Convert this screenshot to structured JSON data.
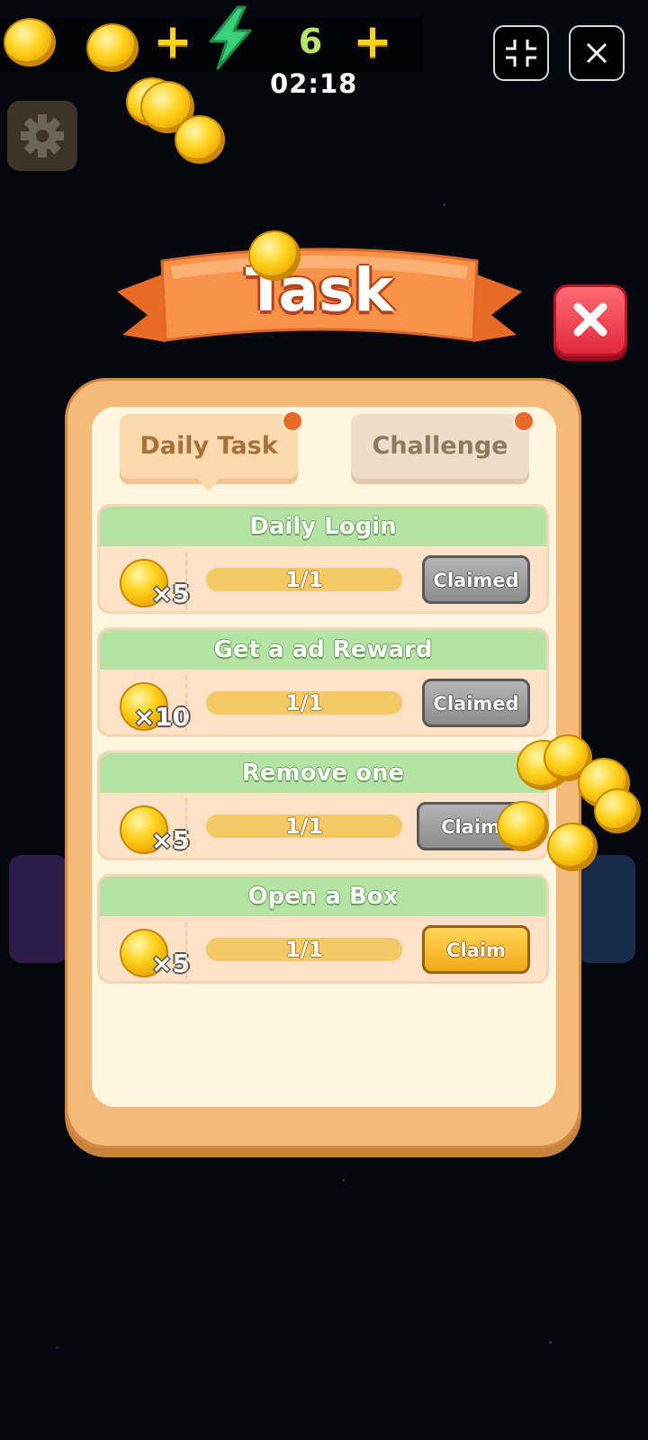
{
  "hud": {
    "energy_count": "6",
    "timer": "02:18"
  },
  "icons": {
    "coin": "coin-icon",
    "energy": "lightning-bolt-icon",
    "plus": "plus-icon",
    "minimize": "collapse-icon",
    "close": "close-icon",
    "settings": "gear-icon"
  },
  "dialog": {
    "title": "Task",
    "tabs": [
      {
        "label": "Daily Task",
        "selected": true,
        "has_notification": true
      },
      {
        "label": "Challenge",
        "selected": false,
        "has_notification": true
      }
    ],
    "tasks": [
      {
        "title": "Daily Login",
        "reward_qty": "×5",
        "progress_text": "1/1",
        "progress": 1.0,
        "button": "Claimed",
        "state": "claimed"
      },
      {
        "title": "Get a ad Reward",
        "reward_qty": "×10",
        "progress_text": "1/1",
        "progress": 1.0,
        "button": "Claimed",
        "state": "claimed"
      },
      {
        "title": "Remove one",
        "reward_qty": "×5",
        "progress_text": "1/1",
        "progress": 1.0,
        "button": "Claim",
        "state": "claim"
      },
      {
        "title": "Open a Box",
        "reward_qty": "×5",
        "progress_text": "1/1",
        "progress": 1.0,
        "button": "Claim",
        "state": "claim"
      }
    ]
  },
  "colors": {
    "panel": "#f3ba7a",
    "task_header": "#b4e3a4",
    "claim_button": "#f2a916",
    "claimed_button": "#9e9e9e",
    "close_button": "#e2283d",
    "banner": "#f08a3c"
  }
}
